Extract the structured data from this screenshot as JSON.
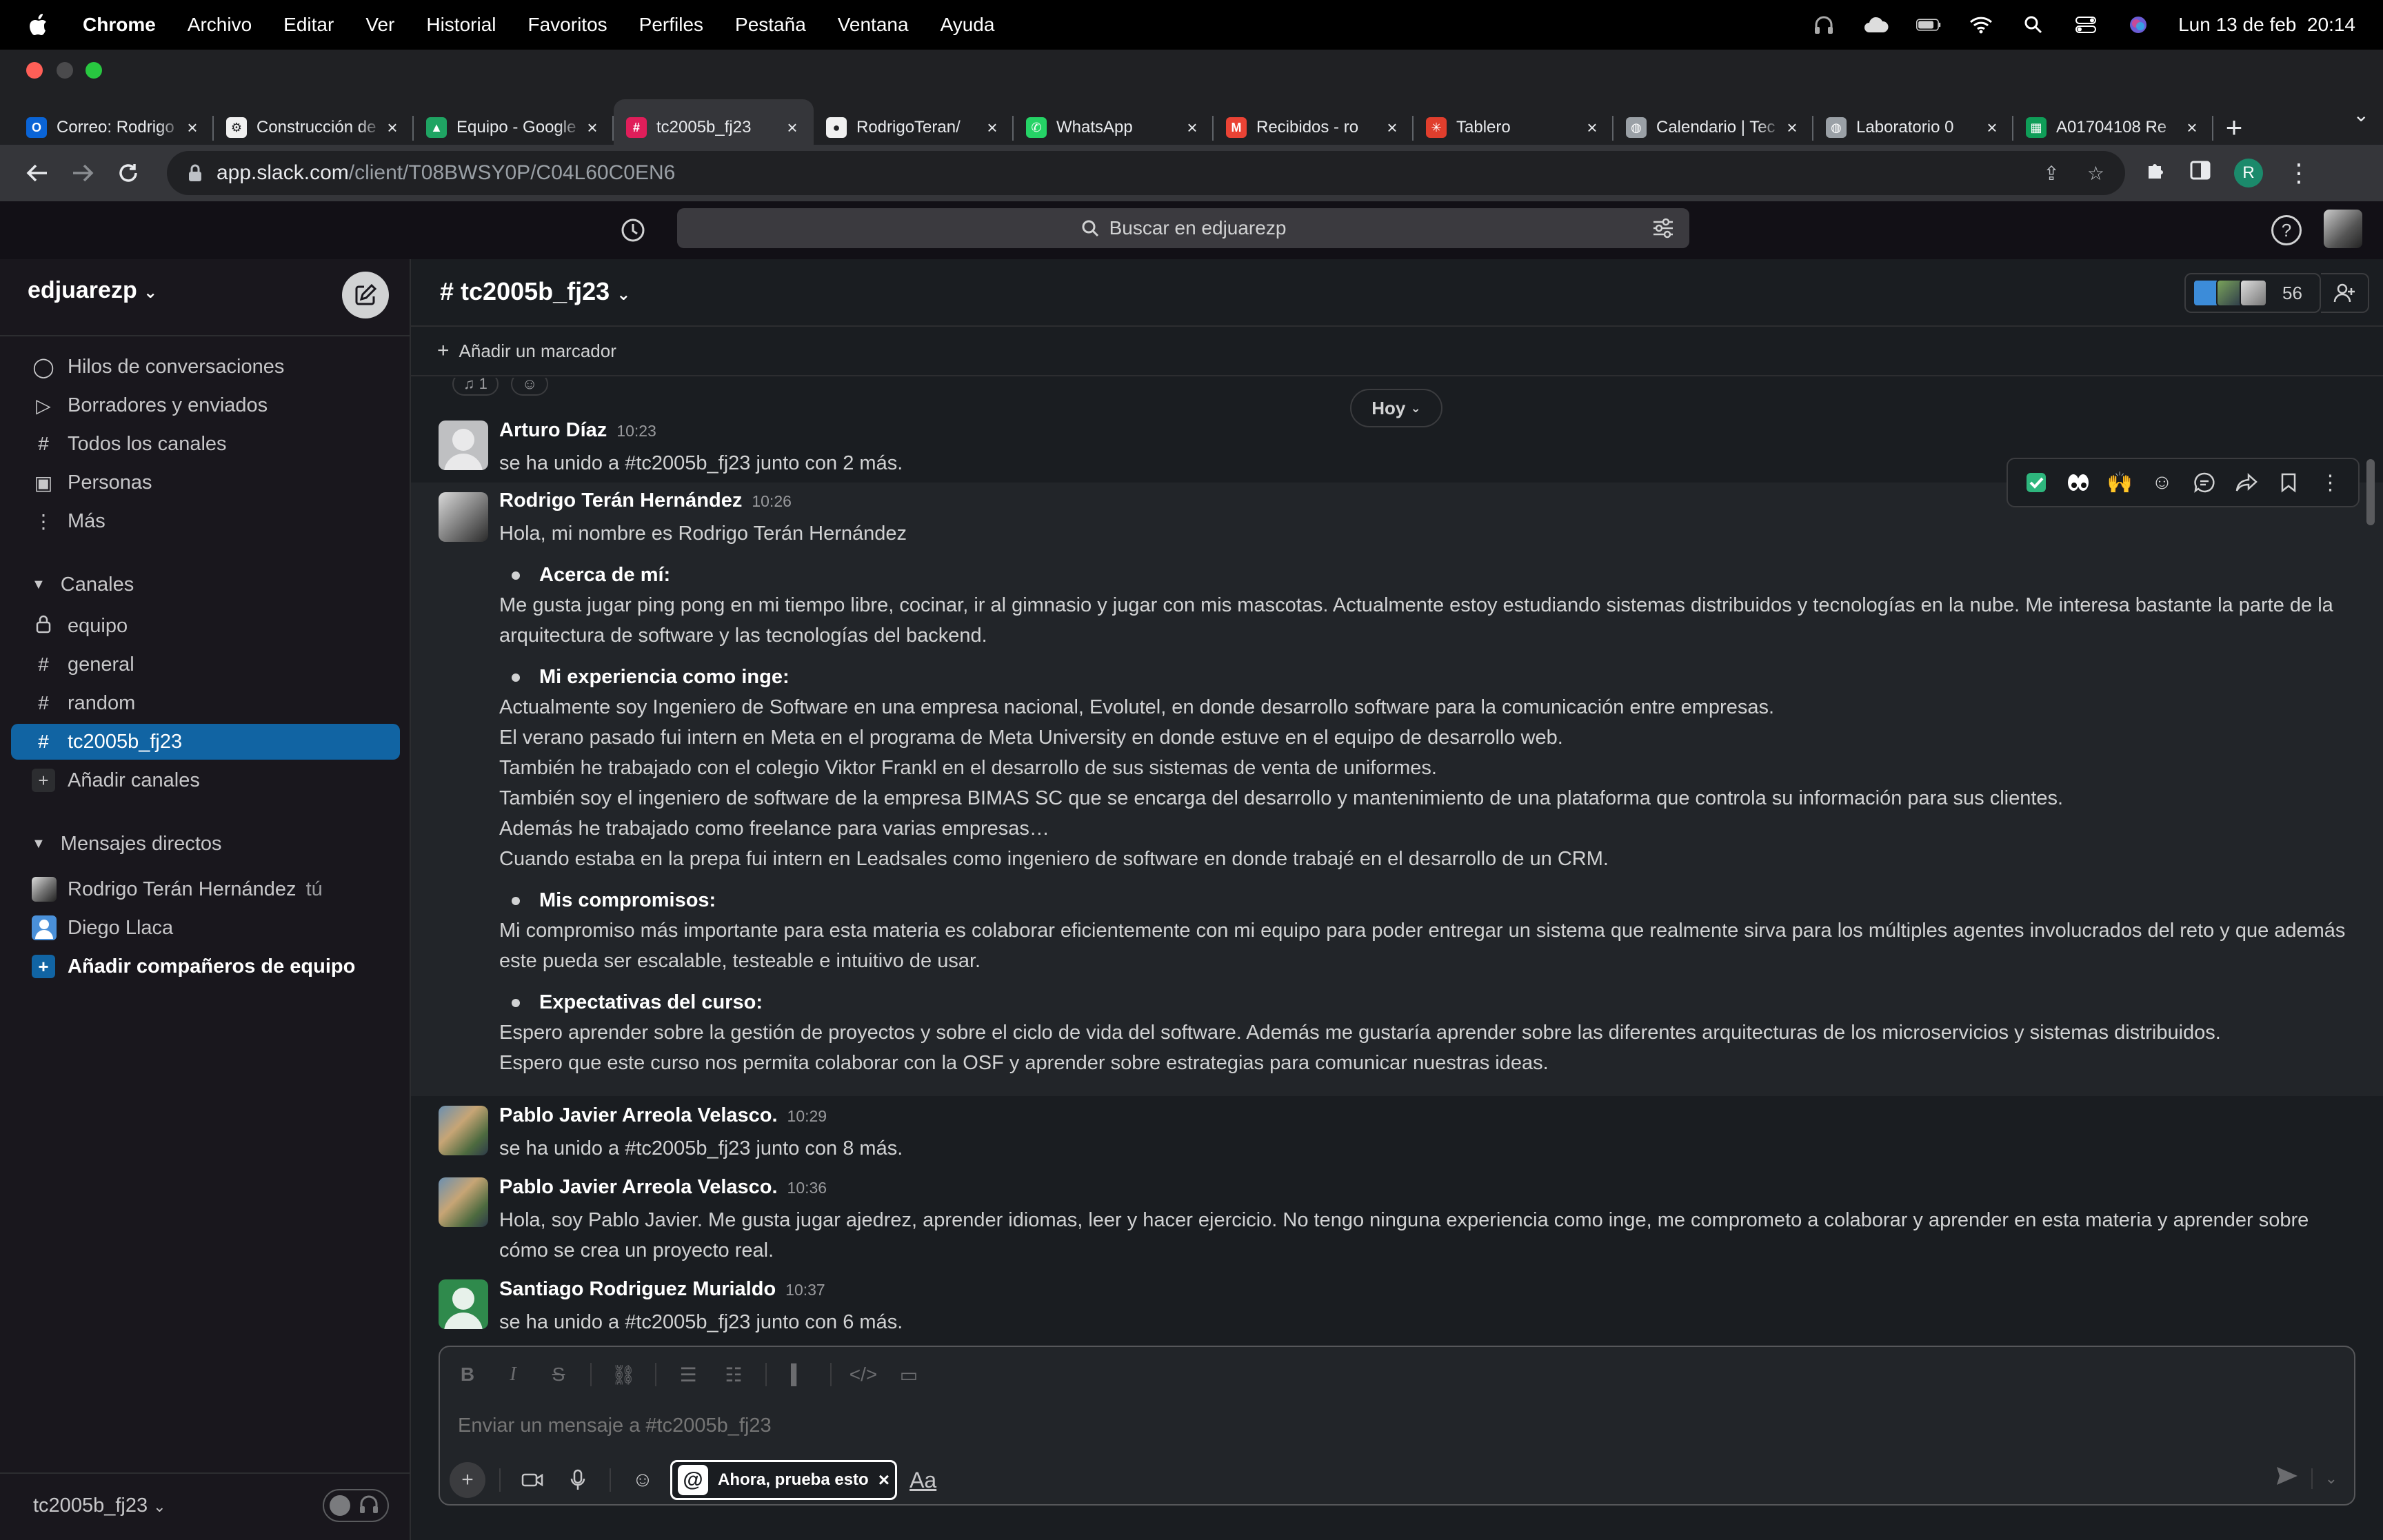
{
  "menubar": {
    "app": "Chrome",
    "items": [
      "Archivo",
      "Editar",
      "Ver",
      "Historial",
      "Favoritos",
      "Perfiles",
      "Pestaña",
      "Ventana",
      "Ayuda"
    ],
    "datetime": "Lun 13 de feb  20:14"
  },
  "tabs": [
    {
      "label": "Correo: Rodrigo",
      "fav_color": "#0a64d6",
      "fav_text": "O"
    },
    {
      "label": "Construcción de",
      "fav_color": "#f0f0f0",
      "fav_text": "⚙"
    },
    {
      "label": "Equipo - Google",
      "fav_color": "#1fa463",
      "fav_text": "▲"
    },
    {
      "label": "tc2005b_fj23",
      "fav_color": "#e01e5a",
      "fav_text": "#",
      "active": true
    },
    {
      "label": "RodrigoTeran/",
      "fav_color": "#f0f0f0",
      "fav_text": "●"
    },
    {
      "label": "WhatsApp",
      "fav_color": "#25d366",
      "fav_text": "✆"
    },
    {
      "label": "Recibidos - ro",
      "fav_color": "#ea4335",
      "fav_text": "M"
    },
    {
      "label": "Tablero",
      "fav_color": "#e03e2d",
      "fav_text": "✳"
    },
    {
      "label": "Calendario | Tec",
      "fav_color": "#9aa0a6",
      "fav_text": "◍"
    },
    {
      "label": "Laboratorio 0",
      "fav_color": "#9aa0a6",
      "fav_text": "◍"
    },
    {
      "label": "A01704108 Re",
      "fav_color": "#0f9d58",
      "fav_text": "▦"
    }
  ],
  "omnibox": {
    "host": "app.slack.com",
    "path": "/client/T08BWSY0P/C04L60C0EN6"
  },
  "search": {
    "placeholder": "Buscar en edjuarezp"
  },
  "sidebar": {
    "workspace": "edjuarezp",
    "nav": [
      {
        "label": "Hilos de conversaciones",
        "icon": "threads-icon"
      },
      {
        "label": "Borradores y enviados",
        "icon": "send-icon"
      },
      {
        "label": "Todos los canales",
        "icon": "channel-browse-icon"
      },
      {
        "label": "Personas",
        "icon": "people-icon"
      },
      {
        "label": "Más",
        "icon": "more-vertical-icon"
      }
    ],
    "channels_header": "Canales",
    "channels": [
      {
        "label": "equipo",
        "icon": "lock-icon"
      },
      {
        "label": "general",
        "icon": "hash-icon"
      },
      {
        "label": "random",
        "icon": "hash-icon"
      },
      {
        "label": "tc2005b_fj23",
        "icon": "hash-icon",
        "active": true
      }
    ],
    "add_channels": "Añadir canales",
    "dms_header": "Mensajes directos",
    "dms": [
      {
        "label": "Rodrigo Terán Hernández",
        "you": "tú"
      },
      {
        "label": "Diego Llaca"
      }
    ],
    "add_teammates": "Añadir compañeros de equipo",
    "footer_channel": "tc2005b_fj23"
  },
  "channel": {
    "name": "tc2005b_fj23",
    "member_count": "56",
    "add_bookmark": "Añadir un marcador",
    "date_divider": "Hoy",
    "reaction_count": "1"
  },
  "messages": [
    {
      "author": "Arturo Díaz",
      "time": "10:23",
      "text": "se ha unido a #tc2005b_fj23 junto con 2 más."
    },
    {
      "author": "Rodrigo Terán Hernández",
      "time": "10:26",
      "intro": "Hola, mi nombre es Rodrigo Terán Hernández",
      "sections": [
        {
          "heading": "Acerca de mí:",
          "lines": [
            "Me gusta jugar ping pong en mi tiempo libre, cocinar, ir al gimnasio y jugar con mis mascotas. Actualmente estoy estudiando sistemas distribuidos y tecnologías en la nube. Me interesa bastante la parte de la arquitectura de software y las tecnologías del backend."
          ]
        },
        {
          "heading": "Mi experiencia como inge:",
          "lines": [
            "Actualmente soy Ingeniero de Software en una empresa nacional, Evolutel, en donde desarrollo software para la comunicación entre empresas.",
            "El verano pasado fui intern en Meta en el programa de Meta University en donde estuve en el equipo de desarrollo web.",
            "También he trabajado con el colegio Viktor Frankl en el desarrollo de sus sistemas de venta de uniformes.",
            "También soy el ingeniero de software de la empresa BIMAS SC que se encarga del desarrollo y mantenimiento de una plataforma que controla su información para sus clientes.",
            "Además he trabajado como freelance para varias empresas…",
            "Cuando estaba en la prepa fui intern en Leadsales como ingeniero de software en donde trabajé en el desarrollo de un CRM."
          ]
        },
        {
          "heading": "Mis compromisos:",
          "lines": [
            "Mi compromiso más importante para esta materia es colaborar eficientemente con mi equipo para poder entregar un sistema que realmente sirva para los múltiples agentes involucrados del reto y que además este pueda ser escalable, testeable e intuitivo de usar."
          ]
        },
        {
          "heading": "Expectativas del curso:",
          "lines": [
            "Espero aprender sobre la gestión de proyectos y sobre el ciclo de vida del software. Además me gustaría aprender sobre las diferentes arquitecturas de los microservicios y sistemas distribuidos.",
            "Espero que este curso nos permita colaborar con la OSF y aprender sobre estrategias para comunicar nuestras ideas."
          ]
        }
      ]
    },
    {
      "author": "Pablo Javier Arreola Velasco.",
      "time": "10:29",
      "text": "se ha unido a #tc2005b_fj23 junto con 8 más."
    },
    {
      "author": "Pablo Javier Arreola Velasco.",
      "time": "10:36",
      "text": "Hola, soy Pablo Javier. Me gusta jugar ajedrez, aprender idiomas, leer y hacer ejercicio. No tengo ninguna experiencia como inge, me comprometo a colaborar y aprender en esta materia y aprender sobre cómo se crea un proyecto real."
    },
    {
      "author": "Santiago Rodriguez Murialdo",
      "time": "10:37",
      "text": "se ha unido a #tc2005b_fj23 junto con 6 más."
    }
  ],
  "message_actions": [
    "check-reaction-icon",
    "eyes-reaction-icon",
    "raised-hands-reaction-icon",
    "add-reaction-icon",
    "reply-thread-icon",
    "share-icon",
    "bookmark-icon",
    "more-actions-icon"
  ],
  "composer": {
    "placeholder": "Enviar un mensaje a #tc2005b_fj23",
    "try_label": "Ahora, prueba esto",
    "format_label": "Aa"
  }
}
